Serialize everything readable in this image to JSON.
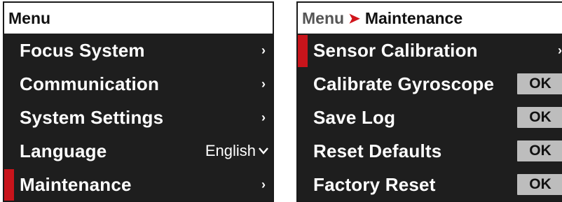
{
  "left_panel": {
    "header": "Menu",
    "items": [
      {
        "label": "Focus System",
        "chevron": "›"
      },
      {
        "label": "Communication",
        "chevron": "›"
      },
      {
        "label": "System Settings",
        "chevron": "›"
      },
      {
        "label": "Language",
        "value": "English",
        "caret": "⌄"
      },
      {
        "label": "Maintenance",
        "chevron": "›",
        "selected": true
      }
    ]
  },
  "right_panel": {
    "breadcrumb": {
      "root": "Menu",
      "separator": "➤",
      "current": "Maintenance"
    },
    "items": [
      {
        "label": "Sensor Calibration",
        "chevron": "›",
        "selected": true
      },
      {
        "label": "Calibrate Gyroscope",
        "button": "OK"
      },
      {
        "label": "Save Log",
        "button": "OK"
      },
      {
        "label": "Reset Defaults",
        "button": "OK"
      },
      {
        "label": "Factory Reset",
        "button": "OK"
      }
    ]
  },
  "colors": {
    "accent": "#c8141b",
    "panel_bg": "#1e1e1e",
    "header_bg": "#ffffff",
    "button_bg": "#bdbdbd"
  }
}
